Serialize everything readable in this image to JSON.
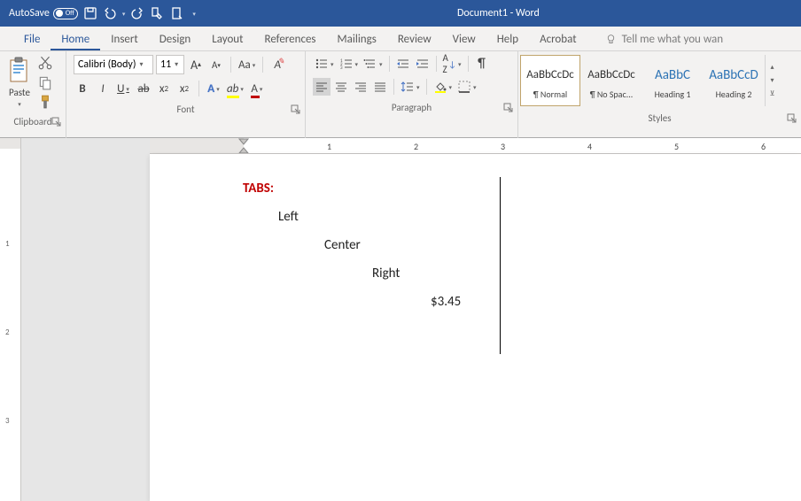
{
  "titlebar": {
    "autosave_label": "AutoSave",
    "toggle_state": "Off",
    "doc_title": "Document1 - Word"
  },
  "tabs": {
    "file": "File",
    "home": "Home",
    "insert": "Insert",
    "design": "Design",
    "layout": "Layout",
    "references": "References",
    "mailings": "Mailings",
    "review": "Review",
    "view": "View",
    "help": "Help",
    "acrobat": "Acrobat",
    "tell": "Tell me what you wan"
  },
  "ribbon": {
    "clipboard": {
      "label": "Clipboard",
      "paste": "Paste"
    },
    "font": {
      "label": "Font",
      "name": "Calibri (Body)",
      "size": "11"
    },
    "paragraph": {
      "label": "Paragraph"
    },
    "styles": {
      "label": "Styles",
      "items": [
        {
          "preview": "AaBbCcDc",
          "name": "¶ Normal"
        },
        {
          "preview": "AaBbCcDc",
          "name": "¶ No Spac..."
        },
        {
          "preview": "AaBbC",
          "name": "Heading 1"
        },
        {
          "preview": "AaBbCcD",
          "name": "Heading 2"
        }
      ]
    }
  },
  "ruler": {
    "nums": [
      "1",
      "2",
      "3",
      "4",
      "5",
      "6"
    ]
  },
  "vruler": {
    "nums": [
      "1",
      "2",
      "3"
    ]
  },
  "document": {
    "heading": "TABS:",
    "lines": [
      "Left",
      "Center",
      "Right",
      "$3.45"
    ]
  }
}
